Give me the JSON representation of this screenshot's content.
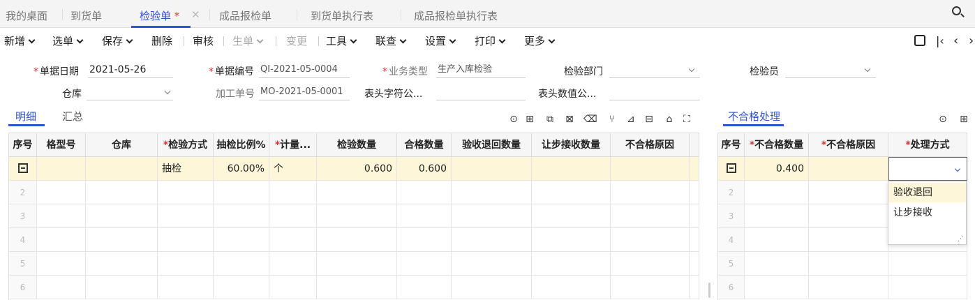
{
  "tabs": [
    {
      "label": "我的桌面",
      "active": false
    },
    {
      "label": "到货单",
      "active": false
    },
    {
      "label": "检验单",
      "active": true,
      "dirty": "*"
    },
    {
      "label": "成品报检单",
      "active": false
    },
    {
      "label": "到货单执行表",
      "active": false
    },
    {
      "label": "成品报检单执行表",
      "active": false
    }
  ],
  "toolbar": {
    "new": "新增",
    "select": "选单",
    "save": "保存",
    "delete": "删除",
    "audit": "审核",
    "generate": "生单",
    "change": "变更",
    "tools": "工具",
    "linkquery": "联查",
    "settings": "设置",
    "print": "打印",
    "more": "更多"
  },
  "header": {
    "doc_date_label": "单据日期",
    "doc_date": "2021-05-26",
    "doc_no_label": "单据编号",
    "doc_no": "QI-2021-05-0004",
    "biz_type_label": "业务类型",
    "biz_type": "生产入库检验",
    "dept_label": "检验部门",
    "dept": "",
    "inspector_label": "检验员",
    "inspector": "",
    "warehouse_label": "仓库",
    "warehouse": "",
    "work_order_label": "加工单号",
    "work_order": "MO-2021-05-0001",
    "char_field_label": "表头字符公...",
    "char_field": "",
    "num_field_label": "表头数值公...",
    "num_field": ""
  },
  "detail_tabs": [
    "明细",
    "汇总"
  ],
  "detail_table": {
    "columns": [
      "序号",
      "格型号",
      "仓库",
      "检验方式",
      "抽检比例%",
      "计量...",
      "检验数量",
      "合格数量",
      "验收退回数量",
      "让步接收数量",
      "不合格原因"
    ],
    "required": [
      false,
      false,
      false,
      true,
      false,
      true,
      false,
      false,
      false,
      false,
      false
    ],
    "rows": [
      {
        "no": "",
        "spec": "",
        "warehouse": "",
        "method": "抽检",
        "ratio": "60.00%",
        "unit": "个",
        "qty": "0.600",
        "ok_qty": "0.600",
        "return_qty": "",
        "concession_qty": "",
        "reason": ""
      },
      {
        "no": "2"
      },
      {
        "no": "3"
      },
      {
        "no": "4"
      },
      {
        "no": "5"
      },
      {
        "no": "6"
      }
    ]
  },
  "ng_panel": {
    "title": "不合格处理",
    "columns": [
      "序号",
      "不合格数量",
      "不合格原因",
      "处理方式"
    ],
    "required": [
      false,
      true,
      true,
      true
    ],
    "rows": [
      {
        "no": "",
        "ng_qty": "0.400",
        "ng_reason": "",
        "handling": ""
      },
      {
        "no": "2"
      },
      {
        "no": "3"
      },
      {
        "no": "4"
      },
      {
        "no": "5"
      },
      {
        "no": "6"
      }
    ],
    "dropdown_options": [
      "验收退回",
      "让步接收"
    ]
  },
  "colors": {
    "accent": "#3355cc",
    "required": "#e03030",
    "selected_row": "#fdf6d8"
  }
}
